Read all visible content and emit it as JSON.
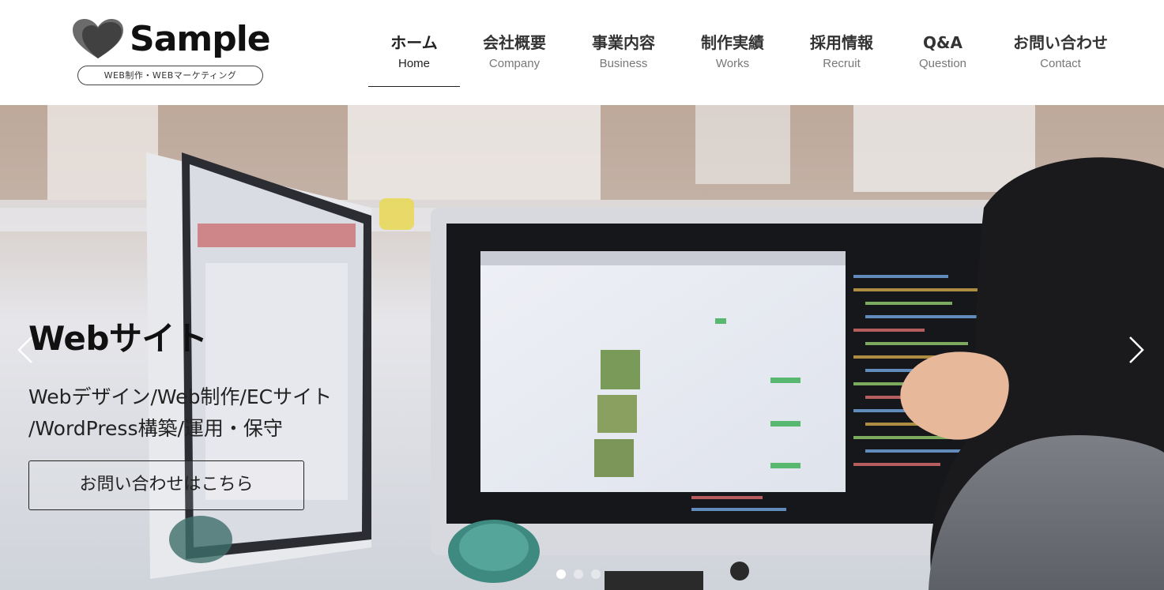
{
  "header": {
    "logo_text": "Sample",
    "logo_tagline": "WEB制作・WEBマーケティング"
  },
  "nav": [
    {
      "jp": "ホーム",
      "en": "Home",
      "active": true
    },
    {
      "jp": "会社概要",
      "en": "Company"
    },
    {
      "jp": "事業内容",
      "en": "Business"
    },
    {
      "jp": "制作実績",
      "en": "Works"
    },
    {
      "jp": "採用情報",
      "en": "Recruit"
    },
    {
      "jp": "Q&A",
      "en": "Question"
    },
    {
      "jp": "お問い合わせ",
      "en": "Contact"
    }
  ],
  "hero": {
    "title": "Webサイト",
    "subtitle_line1": "Webデザイン/Web制作/ECサイト",
    "subtitle_line2": "/WordPress構築/運用・保守",
    "cta_label": "お問い合わせはこちら",
    "slide_count": 3,
    "active_slide": 1
  },
  "colors": {
    "logo_mark": "#4a4a4a",
    "text_dark": "#222222",
    "nav_en": "#777777"
  },
  "icons": {
    "prev": "chevron-left-icon",
    "next": "chevron-right-icon"
  }
}
